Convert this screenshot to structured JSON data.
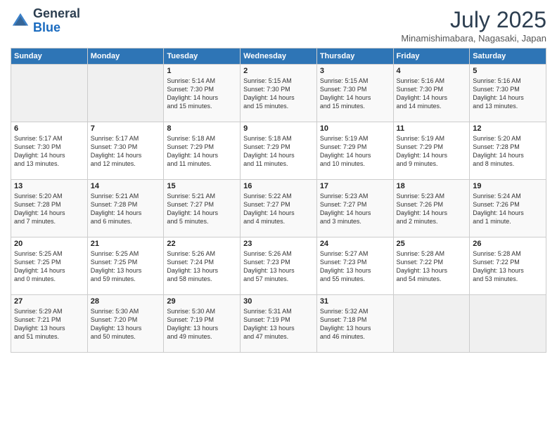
{
  "header": {
    "logo_general": "General",
    "logo_blue": "Blue",
    "month_year": "July 2025",
    "location": "Minamishimabara, Nagasaki, Japan"
  },
  "weekdays": [
    "Sunday",
    "Monday",
    "Tuesday",
    "Wednesday",
    "Thursday",
    "Friday",
    "Saturday"
  ],
  "weeks": [
    [
      {
        "day": "",
        "info": ""
      },
      {
        "day": "",
        "info": ""
      },
      {
        "day": "1",
        "info": "Sunrise: 5:14 AM\nSunset: 7:30 PM\nDaylight: 14 hours\nand 15 minutes."
      },
      {
        "day": "2",
        "info": "Sunrise: 5:15 AM\nSunset: 7:30 PM\nDaylight: 14 hours\nand 15 minutes."
      },
      {
        "day": "3",
        "info": "Sunrise: 5:15 AM\nSunset: 7:30 PM\nDaylight: 14 hours\nand 15 minutes."
      },
      {
        "day": "4",
        "info": "Sunrise: 5:16 AM\nSunset: 7:30 PM\nDaylight: 14 hours\nand 14 minutes."
      },
      {
        "day": "5",
        "info": "Sunrise: 5:16 AM\nSunset: 7:30 PM\nDaylight: 14 hours\nand 13 minutes."
      }
    ],
    [
      {
        "day": "6",
        "info": "Sunrise: 5:17 AM\nSunset: 7:30 PM\nDaylight: 14 hours\nand 13 minutes."
      },
      {
        "day": "7",
        "info": "Sunrise: 5:17 AM\nSunset: 7:30 PM\nDaylight: 14 hours\nand 12 minutes."
      },
      {
        "day": "8",
        "info": "Sunrise: 5:18 AM\nSunset: 7:29 PM\nDaylight: 14 hours\nand 11 minutes."
      },
      {
        "day": "9",
        "info": "Sunrise: 5:18 AM\nSunset: 7:29 PM\nDaylight: 14 hours\nand 11 minutes."
      },
      {
        "day": "10",
        "info": "Sunrise: 5:19 AM\nSunset: 7:29 PM\nDaylight: 14 hours\nand 10 minutes."
      },
      {
        "day": "11",
        "info": "Sunrise: 5:19 AM\nSunset: 7:29 PM\nDaylight: 14 hours\nand 9 minutes."
      },
      {
        "day": "12",
        "info": "Sunrise: 5:20 AM\nSunset: 7:28 PM\nDaylight: 14 hours\nand 8 minutes."
      }
    ],
    [
      {
        "day": "13",
        "info": "Sunrise: 5:20 AM\nSunset: 7:28 PM\nDaylight: 14 hours\nand 7 minutes."
      },
      {
        "day": "14",
        "info": "Sunrise: 5:21 AM\nSunset: 7:28 PM\nDaylight: 14 hours\nand 6 minutes."
      },
      {
        "day": "15",
        "info": "Sunrise: 5:21 AM\nSunset: 7:27 PM\nDaylight: 14 hours\nand 5 minutes."
      },
      {
        "day": "16",
        "info": "Sunrise: 5:22 AM\nSunset: 7:27 PM\nDaylight: 14 hours\nand 4 minutes."
      },
      {
        "day": "17",
        "info": "Sunrise: 5:23 AM\nSunset: 7:27 PM\nDaylight: 14 hours\nand 3 minutes."
      },
      {
        "day": "18",
        "info": "Sunrise: 5:23 AM\nSunset: 7:26 PM\nDaylight: 14 hours\nand 2 minutes."
      },
      {
        "day": "19",
        "info": "Sunrise: 5:24 AM\nSunset: 7:26 PM\nDaylight: 14 hours\nand 1 minute."
      }
    ],
    [
      {
        "day": "20",
        "info": "Sunrise: 5:25 AM\nSunset: 7:25 PM\nDaylight: 14 hours\nand 0 minutes."
      },
      {
        "day": "21",
        "info": "Sunrise: 5:25 AM\nSunset: 7:25 PM\nDaylight: 13 hours\nand 59 minutes."
      },
      {
        "day": "22",
        "info": "Sunrise: 5:26 AM\nSunset: 7:24 PM\nDaylight: 13 hours\nand 58 minutes."
      },
      {
        "day": "23",
        "info": "Sunrise: 5:26 AM\nSunset: 7:23 PM\nDaylight: 13 hours\nand 57 minutes."
      },
      {
        "day": "24",
        "info": "Sunrise: 5:27 AM\nSunset: 7:23 PM\nDaylight: 13 hours\nand 55 minutes."
      },
      {
        "day": "25",
        "info": "Sunrise: 5:28 AM\nSunset: 7:22 PM\nDaylight: 13 hours\nand 54 minutes."
      },
      {
        "day": "26",
        "info": "Sunrise: 5:28 AM\nSunset: 7:22 PM\nDaylight: 13 hours\nand 53 minutes."
      }
    ],
    [
      {
        "day": "27",
        "info": "Sunrise: 5:29 AM\nSunset: 7:21 PM\nDaylight: 13 hours\nand 51 minutes."
      },
      {
        "day": "28",
        "info": "Sunrise: 5:30 AM\nSunset: 7:20 PM\nDaylight: 13 hours\nand 50 minutes."
      },
      {
        "day": "29",
        "info": "Sunrise: 5:30 AM\nSunset: 7:19 PM\nDaylight: 13 hours\nand 49 minutes."
      },
      {
        "day": "30",
        "info": "Sunrise: 5:31 AM\nSunset: 7:19 PM\nDaylight: 13 hours\nand 47 minutes."
      },
      {
        "day": "31",
        "info": "Sunrise: 5:32 AM\nSunset: 7:18 PM\nDaylight: 13 hours\nand 46 minutes."
      },
      {
        "day": "",
        "info": ""
      },
      {
        "day": "",
        "info": ""
      }
    ]
  ]
}
